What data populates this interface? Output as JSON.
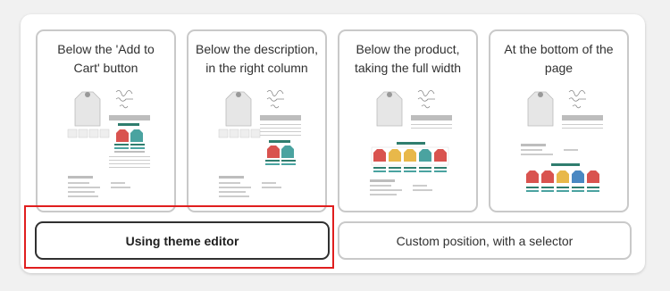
{
  "placement_options": [
    {
      "label": "Below the 'Add to Cart' button",
      "line1": "Below the 'Add to",
      "line2": "Cart' button"
    },
    {
      "label": "Below the description, in the right column",
      "line1": "Below the description,",
      "line2": "in the right column"
    },
    {
      "label": "Below the product, taking the full width",
      "line1": "Below the product,",
      "line2": "taking the full width"
    },
    {
      "label": "At the bottom of the page",
      "line1": "At the bottom of the",
      "line2": "page"
    }
  ],
  "method_options": {
    "theme_editor": "Using theme editor",
    "custom_position": "Custom position, with a selector"
  },
  "selected_method": "theme_editor",
  "colors": {
    "highlight": "#e01e1e",
    "teal": "#2f7d6e",
    "jacket_red": "#d9534f",
    "jacket_teal": "#4aa3a0",
    "jacket_yellow": "#e8b84a",
    "jacket_blue": "#4a88c2"
  }
}
